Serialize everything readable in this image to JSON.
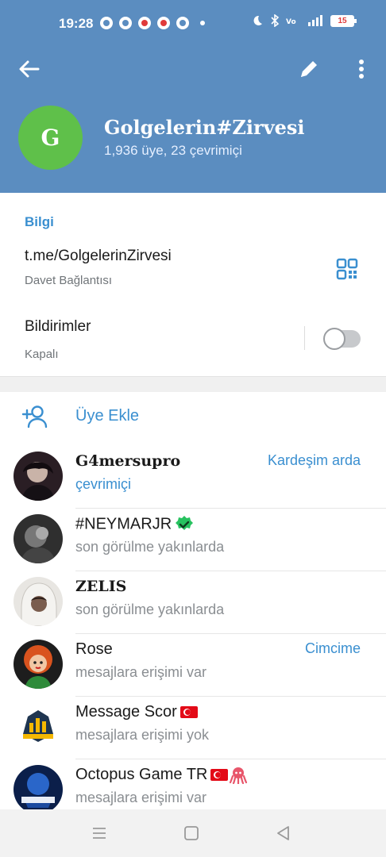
{
  "status_bar": {
    "time": "19:28",
    "battery": "15",
    "icons": [
      "notification-icon",
      "bip-icon",
      "vodafone-icon",
      "pinterest-icon",
      "app-icon",
      "moon-icon",
      "bluetooth-icon",
      "volte-icon",
      "signal-icon",
      "battery-icon"
    ]
  },
  "header": {
    "avatar_letter": "G",
    "title": "Golgelerin#Zirvesi",
    "subtitle": "1,936 üye, 23 çevrimiçi",
    "colors": {
      "bg": "#5b8dc0",
      "avatar": "#5fc04a"
    }
  },
  "info": {
    "section_label": "Bilgi",
    "link": "t.me/GolgelerinZirvesi",
    "link_caption": "Davet Bağlantısı",
    "notifications_label": "Bildirimler",
    "notifications_state": "Kapalı",
    "notifications_on": false
  },
  "add_member": {
    "label": "Üye Ekle"
  },
  "members": [
    {
      "name": "G4mersupro",
      "status": "çevrimiçi",
      "role": "Kardeşim arda"
    },
    {
      "name": "#NEYMARJR",
      "status": "son görülme yakınlarda",
      "role": ""
    },
    {
      "name": "ZELIS",
      "status": "son görülme yakınlarda",
      "role": ""
    },
    {
      "name": "Rose",
      "status": "mesajlara erişimi var",
      "role": "Cimcime"
    },
    {
      "name": "Message Scor",
      "status": "mesajlara erişimi yok",
      "role": ""
    },
    {
      "name": "Octopus Game TR",
      "status": "mesajlara erişimi var",
      "role": ""
    }
  ],
  "accent_color": "#3a8fd0"
}
